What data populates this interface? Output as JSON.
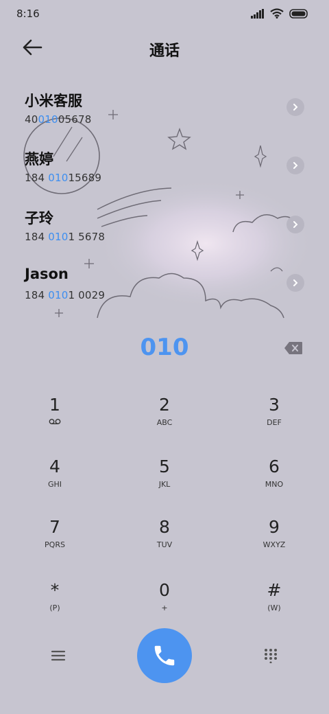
{
  "status": {
    "time": "8:16"
  },
  "header": {
    "title": "通话"
  },
  "contacts": [
    {
      "name": "小米客服",
      "num_pre": "40",
      "num_match": "010",
      "num_post": "05678"
    },
    {
      "name": "燕婷",
      "num_pre": "184 ",
      "num_match": "010",
      "num_post": "15689"
    },
    {
      "name": "子玲",
      "num_pre": "184 ",
      "num_match": "010",
      "num_post": "1 5678"
    },
    {
      "name": "Jason",
      "num_pre": "184 ",
      "num_match": "010",
      "num_post": "1 0029"
    }
  ],
  "dialed": "010",
  "keys": [
    {
      "digit": "1",
      "letters": ""
    },
    {
      "digit": "2",
      "letters": "ABC"
    },
    {
      "digit": "3",
      "letters": "DEF"
    },
    {
      "digit": "4",
      "letters": "GHI"
    },
    {
      "digit": "5",
      "letters": "JKL"
    },
    {
      "digit": "6",
      "letters": "MNO"
    },
    {
      "digit": "7",
      "letters": "PQRS"
    },
    {
      "digit": "8",
      "letters": "TUV"
    },
    {
      "digit": "9",
      "letters": "WXYZ"
    },
    {
      "digit": "*",
      "letters": "(P)"
    },
    {
      "digit": "0",
      "letters": "+"
    },
    {
      "digit": "#",
      "letters": "(W)"
    }
  ],
  "colors": {
    "accent": "#4d94f0",
    "background": "#c7c5d0"
  }
}
